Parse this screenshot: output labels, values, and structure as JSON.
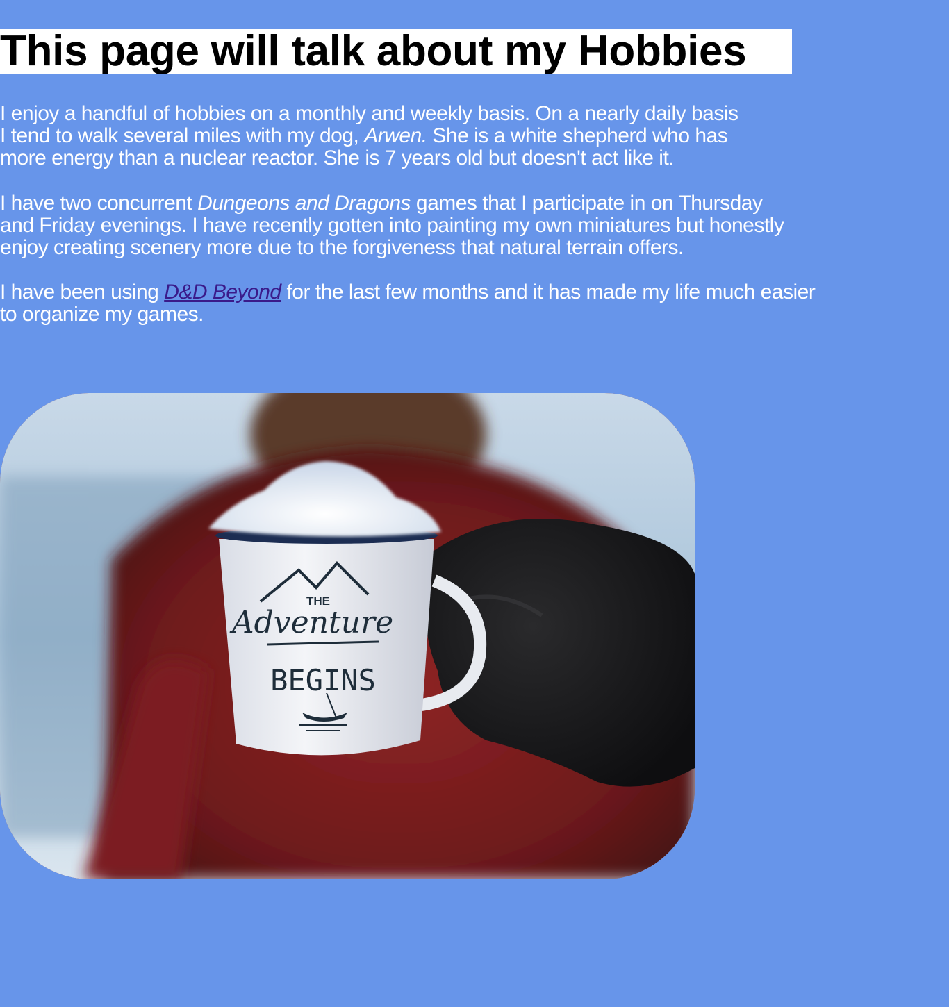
{
  "title": "This page will talk about my Hobbies",
  "paragraph1": {
    "line1": "I enjoy a handful of hobbies on a monthly and weekly basis. On a nearly daily basis",
    "line2_before": "I tend to walk several miles with my dog, ",
    "dog_name": "Arwen.",
    "line2_after": " She is a white shepherd who has",
    "line3": "more energy than a nuclear reactor. She is 7 years old but doesn't act like it."
  },
  "paragraph2": {
    "line1_before": "I have two concurrent ",
    "game_name": "Dungeons and Dragons",
    "line1_after": " games that I participate in on Thursday",
    "line2": "and Friday evenings. I have recently gotten into painting my own miniatures but honestly",
    "line3": "enjoy creating scenery more due to the forgiveness that natural terrain offers."
  },
  "paragraph3": {
    "line1_before": "I have been using ",
    "link_text": "D&D Beyond",
    "line1_after": " for the last few months and it has made my life much easier",
    "line2": "to organize my games."
  },
  "photo": {
    "mug_text_top": "THE",
    "mug_text_script": "Adventure",
    "mug_text_bottom": "BEGINS"
  },
  "colors": {
    "background": "#6795EA",
    "title_bg": "#FFFFFF",
    "link": "#3A1A8A"
  }
}
